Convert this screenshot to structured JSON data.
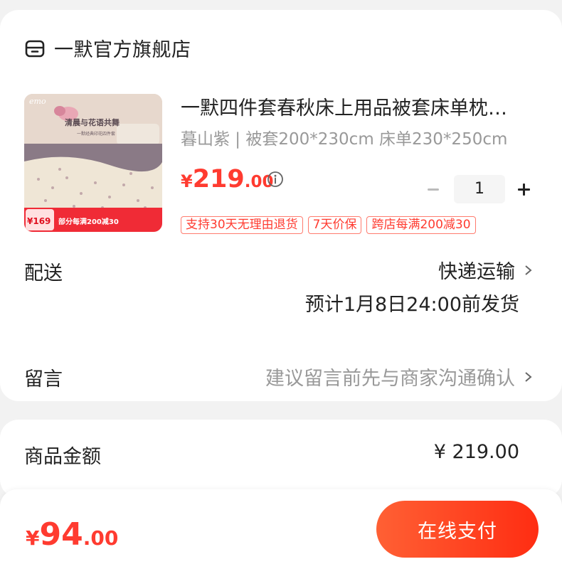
{
  "shop": {
    "name": "一默官方旗舰店"
  },
  "product": {
    "title": "一默四件套春秋床上用品被套床单枕…",
    "spec": "暮山紫 | 被套200*230cm 床单230*250cm",
    "price_currency": "¥",
    "price_int": "219",
    "price_dec": ".00",
    "quantity": "1",
    "tags": [
      "支持30天无理由退货",
      "7天价保",
      "跨店每满200减30"
    ],
    "thumb": {
      "brand": "emo",
      "headline": "清晨与花语共舞",
      "subline": "一默经典印花四件套",
      "promo_price": "¥169",
      "promo_text": "部分每满200减30"
    }
  },
  "delivery": {
    "label": "配送",
    "method": "快递运输",
    "eta": "预计1月8日24:00前发货"
  },
  "message": {
    "label": "留言",
    "placeholder": "建议留言前先与商家沟通确认"
  },
  "amount": {
    "label": "商品金额",
    "value": "¥ 219.00"
  },
  "bottom": {
    "currency": "¥",
    "total_int": "94",
    "total_dec": ".00",
    "pay_label": "在线支付"
  },
  "colors": {
    "accent": "#ff3b30",
    "pay_gradient_start": "#ff6034",
    "pay_gradient_end": "#ff2d12"
  }
}
